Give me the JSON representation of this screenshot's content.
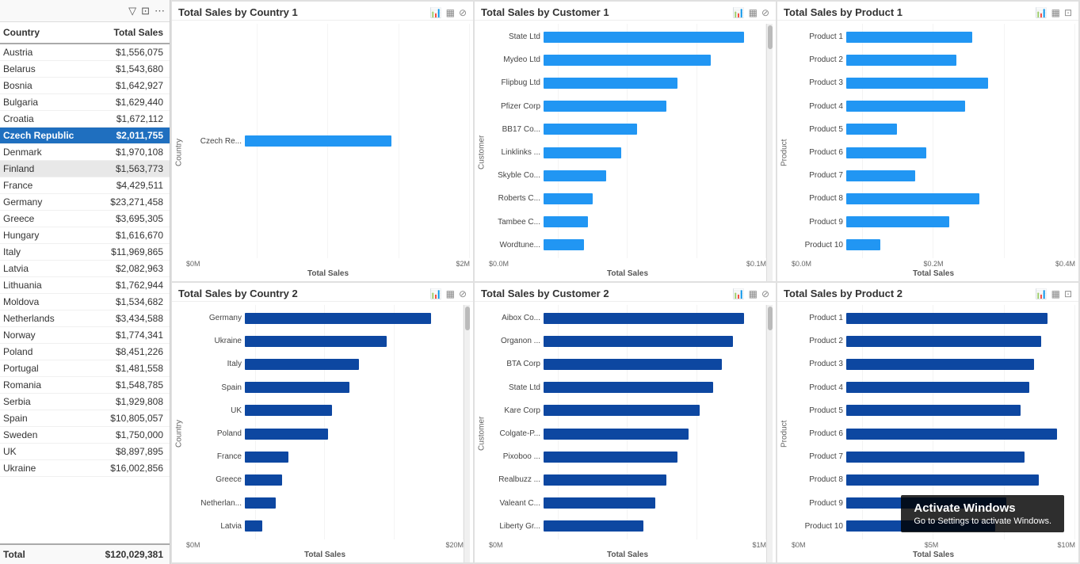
{
  "leftPanel": {
    "toolbar": {
      "filterIcon": "▽",
      "expandIcon": "⊡",
      "moreIcon": "⋯"
    },
    "table": {
      "headers": {
        "country": "Country",
        "sales": "Total Sales"
      },
      "rows": [
        {
          "country": "Austria",
          "sales": "$1,556,075",
          "highlight": false
        },
        {
          "country": "Belarus",
          "sales": "$1,543,680",
          "highlight": false
        },
        {
          "country": "Bosnia",
          "sales": "$1,642,927",
          "highlight": false
        },
        {
          "country": "Bulgaria",
          "sales": "$1,629,440",
          "highlight": false
        },
        {
          "country": "Croatia",
          "sales": "$1,672,112",
          "highlight": false
        },
        {
          "country": "Czech Republic",
          "sales": "$2,011,755",
          "highlight": true
        },
        {
          "country": "Denmark",
          "sales": "$1,970,108",
          "highlight": false
        },
        {
          "country": "Finland",
          "sales": "$1,563,773",
          "highlight": false,
          "hover": true
        },
        {
          "country": "France",
          "sales": "$4,429,511",
          "highlight": false
        },
        {
          "country": "Germany",
          "sales": "$23,271,458",
          "highlight": false
        },
        {
          "country": "Greece",
          "sales": "$3,695,305",
          "highlight": false
        },
        {
          "country": "Hungary",
          "sales": "$1,616,670",
          "highlight": false
        },
        {
          "country": "Italy",
          "sales": "$11,969,865",
          "highlight": false
        },
        {
          "country": "Latvia",
          "sales": "$2,082,963",
          "highlight": false
        },
        {
          "country": "Lithuania",
          "sales": "$1,762,944",
          "highlight": false
        },
        {
          "country": "Moldova",
          "sales": "$1,534,682",
          "highlight": false
        },
        {
          "country": "Netherlands",
          "sales": "$3,434,588",
          "highlight": false
        },
        {
          "country": "Norway",
          "sales": "$1,774,341",
          "highlight": false
        },
        {
          "country": "Poland",
          "sales": "$8,451,226",
          "highlight": false
        },
        {
          "country": "Portugal",
          "sales": "$1,481,558",
          "highlight": false
        },
        {
          "country": "Romania",
          "sales": "$1,548,785",
          "highlight": false
        },
        {
          "country": "Serbia",
          "sales": "$1,929,808",
          "highlight": false
        },
        {
          "country": "Spain",
          "sales": "$10,805,057",
          "highlight": false
        },
        {
          "country": "Sweden",
          "sales": "$1,750,000",
          "highlight": false
        },
        {
          "country": "UK",
          "sales": "$8,897,895",
          "highlight": false
        },
        {
          "country": "Ukraine",
          "sales": "$16,002,856",
          "highlight": false
        }
      ],
      "footer": {
        "label": "Total",
        "value": "$120,029,381"
      }
    }
  },
  "charts": {
    "topLeft": {
      "title": "Total Sales by Country 1",
      "yAxisLabel": "Country",
      "xAxisLabel": "Total Sales",
      "xTicks": [
        "$0M",
        "$2M"
      ],
      "bars": [
        {
          "label": "Czech Re...",
          "value": 65,
          "color": "light"
        }
      ]
    },
    "topMiddle": {
      "title": "Total Sales by Customer 1",
      "yAxisLabel": "Customer",
      "xAxisLabel": "Total Sales",
      "xTicks": [
        "$0.0M",
        "$0.1M"
      ],
      "bars": [
        {
          "label": "State Ltd",
          "value": 90,
          "color": "light"
        },
        {
          "label": "Mydeo Ltd",
          "value": 75,
          "color": "light"
        },
        {
          "label": "Flipbug Ltd",
          "value": 60,
          "color": "light"
        },
        {
          "label": "Pfizer Corp",
          "value": 55,
          "color": "light"
        },
        {
          "label": "BB17 Co...",
          "value": 42,
          "color": "light"
        },
        {
          "label": "Linklinks ...",
          "value": 35,
          "color": "light"
        },
        {
          "label": "Skyble Co...",
          "value": 28,
          "color": "light"
        },
        {
          "label": "Roberts C...",
          "value": 22,
          "color": "light"
        },
        {
          "label": "Tambee C...",
          "value": 20,
          "color": "light"
        },
        {
          "label": "Wordtune...",
          "value": 18,
          "color": "light"
        }
      ]
    },
    "topRight": {
      "title": "Total Sales by Product 1",
      "yAxisLabel": "Product",
      "xAxisLabel": "Total Sales",
      "xTicks": [
        "$0.0M",
        "$0.2M",
        "$0.4M"
      ],
      "bars": [
        {
          "label": "Product 1",
          "value": 55,
          "color": "light"
        },
        {
          "label": "Product 2",
          "value": 48,
          "color": "light"
        },
        {
          "label": "Product 3",
          "value": 62,
          "color": "light"
        },
        {
          "label": "Product 4",
          "value": 52,
          "color": "light"
        },
        {
          "label": "Product 5",
          "value": 22,
          "color": "light"
        },
        {
          "label": "Product 6",
          "value": 35,
          "color": "light"
        },
        {
          "label": "Product 7",
          "value": 30,
          "color": "light"
        },
        {
          "label": "Product 8",
          "value": 58,
          "color": "light"
        },
        {
          "label": "Product 9",
          "value": 45,
          "color": "light"
        },
        {
          "label": "Product 10",
          "value": 15,
          "color": "light"
        }
      ]
    },
    "bottomLeft": {
      "title": "Total Sales by Country 2",
      "yAxisLabel": "Country",
      "xAxisLabel": "Total Sales",
      "xTicks": [
        "$0M",
        "$20M"
      ],
      "bars": [
        {
          "label": "Germany",
          "value": 85,
          "color": "dark"
        },
        {
          "label": "Ukraine",
          "value": 65,
          "color": "dark"
        },
        {
          "label": "Italy",
          "value": 52,
          "color": "dark"
        },
        {
          "label": "Spain",
          "value": 48,
          "color": "dark"
        },
        {
          "label": "UK",
          "value": 40,
          "color": "dark"
        },
        {
          "label": "Poland",
          "value": 38,
          "color": "dark"
        },
        {
          "label": "France",
          "value": 20,
          "color": "dark"
        },
        {
          "label": "Greece",
          "value": 17,
          "color": "dark"
        },
        {
          "label": "Netherlan...",
          "value": 14,
          "color": "dark"
        },
        {
          "label": "Latvia",
          "value": 8,
          "color": "dark"
        }
      ]
    },
    "bottomMiddle": {
      "title": "Total Sales by Customer 2",
      "yAxisLabel": "Customer",
      "xAxisLabel": "Total Sales",
      "xTicks": [
        "$0M",
        "$1M"
      ],
      "bars": [
        {
          "label": "Aibox Co...",
          "value": 90,
          "color": "dark"
        },
        {
          "label": "Organon ...",
          "value": 85,
          "color": "dark"
        },
        {
          "label": "BTA Corp",
          "value": 80,
          "color": "dark"
        },
        {
          "label": "State Ltd",
          "value": 76,
          "color": "dark"
        },
        {
          "label": "Kare Corp",
          "value": 70,
          "color": "dark"
        },
        {
          "label": "Colgate-P...",
          "value": 65,
          "color": "dark"
        },
        {
          "label": "Pixoboo ...",
          "value": 60,
          "color": "dark"
        },
        {
          "label": "Realbuzz ...",
          "value": 55,
          "color": "dark"
        },
        {
          "label": "Valeant C...",
          "value": 50,
          "color": "dark"
        },
        {
          "label": "Liberty Gr...",
          "value": 45,
          "color": "dark"
        }
      ]
    },
    "bottomRight": {
      "title": "Total Sales by Product 2",
      "yAxisLabel": "Product",
      "xAxisLabel": "Total Sales",
      "xTicks": [
        "$0M",
        "$5M",
        "$10M"
      ],
      "bars": [
        {
          "label": "Product 1",
          "value": 88,
          "color": "dark"
        },
        {
          "label": "Product 2",
          "value": 85,
          "color": "dark"
        },
        {
          "label": "Product 3",
          "value": 82,
          "color": "dark"
        },
        {
          "label": "Product 4",
          "value": 80,
          "color": "dark"
        },
        {
          "label": "Product 5",
          "value": 76,
          "color": "dark"
        },
        {
          "label": "Product 6",
          "value": 92,
          "color": "dark"
        },
        {
          "label": "Product 7",
          "value": 78,
          "color": "dark"
        },
        {
          "label": "Product 8",
          "value": 84,
          "color": "dark"
        },
        {
          "label": "Product 9",
          "value": 70,
          "color": "dark"
        },
        {
          "label": "Product 10",
          "value": 65,
          "color": "dark"
        }
      ]
    }
  },
  "windowsActivate": {
    "title": "Activate Windows",
    "subtitle": "Go to Settings to activate Windows."
  }
}
